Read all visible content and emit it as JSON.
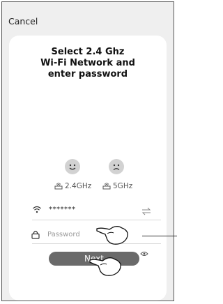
{
  "header": {
    "cancel_label": "Cancel"
  },
  "title": {
    "line1": "Select 2.4 Ghz",
    "line2": "Wi-Fi Network and",
    "line3": "enter password"
  },
  "bands": [
    {
      "label": "2.4GHz",
      "icon": "smile-face-icon"
    },
    {
      "label": "5GHz",
      "icon": "frown-face-icon"
    }
  ],
  "wifi": {
    "ssid_value": "*******",
    "password_placeholder": "Password"
  },
  "actions": {
    "next_label": "Next"
  },
  "colors": {
    "background": "#efefef",
    "card": "#ffffff",
    "button": "#6a6a6a",
    "face": "#d2d2d2"
  }
}
